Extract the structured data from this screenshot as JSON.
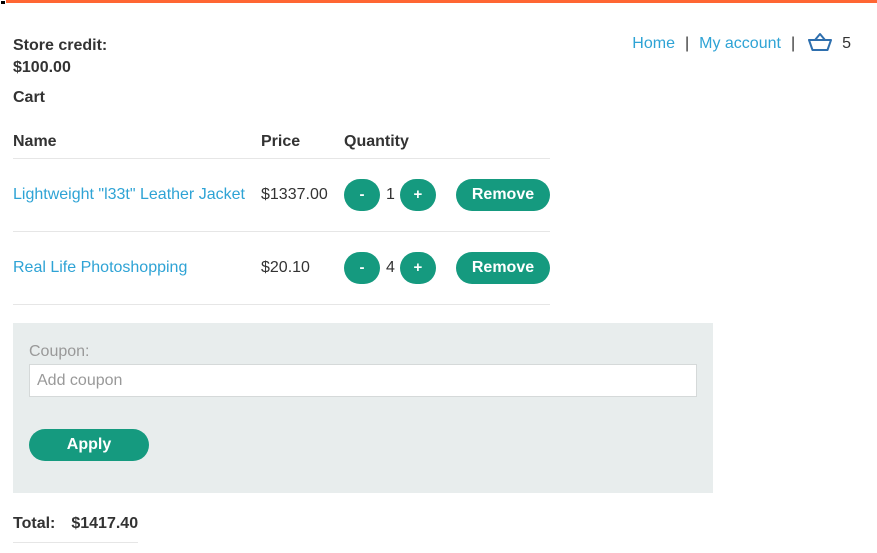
{
  "header": {
    "store_credit_label": "Store credit:",
    "store_credit_value": "$100.00",
    "nav": {
      "home": "Home",
      "my_account": "My account",
      "separator": "|",
      "cart_icon": "basket-icon",
      "cart_count": "5"
    }
  },
  "cart": {
    "heading": "Cart",
    "columns": [
      "Name",
      "Price",
      "Quantity"
    ],
    "items": [
      {
        "name": "Lightweight \"l33t\" Leather Jacket",
        "price": "$1337.00",
        "quantity": "1",
        "minus": "-",
        "plus": "+",
        "remove": "Remove"
      },
      {
        "name": "Real Life Photoshopping",
        "price": "$20.10",
        "quantity": "4",
        "minus": "-",
        "plus": "+",
        "remove": "Remove"
      }
    ]
  },
  "coupon": {
    "label": "Coupon:",
    "placeholder": "Add coupon",
    "value": "",
    "apply": "Apply"
  },
  "total": {
    "label": "Total:",
    "value": "$1417.40"
  },
  "colors": {
    "accent_bar": "#ff6633",
    "button": "#159a7f",
    "link": "#2ea3d5",
    "coupon_bg": "#e8eded"
  }
}
